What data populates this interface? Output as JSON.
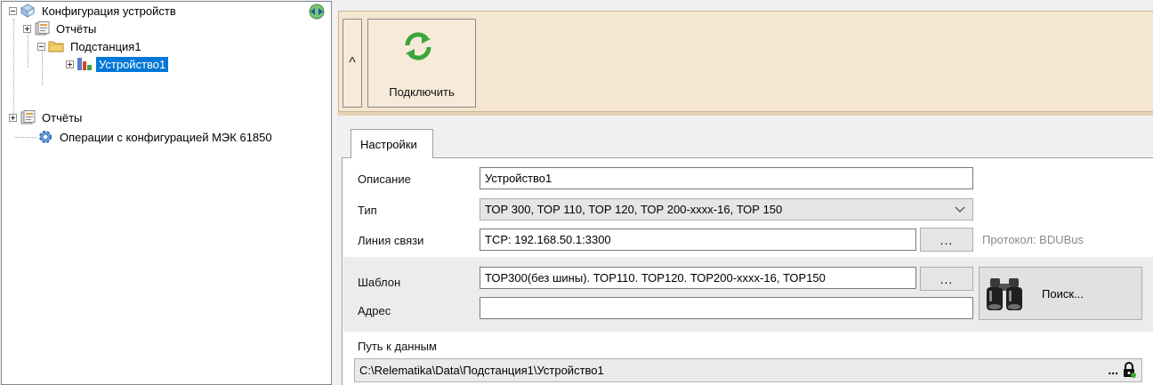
{
  "tree": {
    "items": [
      {
        "label": "Конфигурация устройств",
        "icon": "device-config-icon",
        "expanded": true
      },
      {
        "label": "Отчёты",
        "icon": "reports-icon",
        "expanded": false
      },
      {
        "label": "Подстанция1",
        "icon": "folder-icon",
        "expanded": true
      },
      {
        "label": "Устройство1",
        "icon": "device-icon",
        "expanded": false,
        "selected": true
      },
      {
        "label": "Отчёты",
        "icon": "reports-icon",
        "expanded": false
      },
      {
        "label": "Операции с конфигурацией МЭК 61850",
        "icon": "gear-icon"
      }
    ]
  },
  "ribbon": {
    "collapse_glyph": "^",
    "connect_label": "Подключить"
  },
  "tab": {
    "label": "Настройки"
  },
  "form": {
    "description_label": "Описание",
    "description_value": "Устройство1",
    "type_label": "Тип",
    "type_value": "ТОР 300, ТОР 110, ТОР 120, ТОР 200-xxxx-16, ТОР 150",
    "line_label": "Линия связи",
    "line_value": "TCP: 192.168.50.1:3300",
    "line_button": "...",
    "protocol_note": "Протокол: BDUBus",
    "template_label": "Шаблон",
    "template_value": "ТОР300(без шины). ТОР110. ТОР120. ТОР200-xxxx-16, ТОР150",
    "template_button": "...",
    "address_label": "Адрес",
    "address_value": "",
    "search_label": "Поиск...",
    "path_label": "Путь к данным",
    "path_value": "C:\\Relematika\\Data\\Подстанция1\\Устройство1",
    "path_button": "..."
  },
  "colors": {
    "ribbon_bg": "#f5e6d0",
    "selection": "#0078d7"
  }
}
